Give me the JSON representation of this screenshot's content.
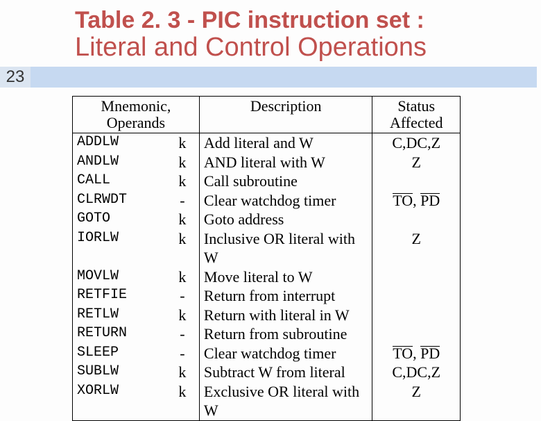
{
  "page_number": "23",
  "title_line1": "Table 2. 3 - PIC instruction set :",
  "title_line2": "Literal and Control Operations",
  "headers": {
    "mnemonic": "Mnemonic,\nOperands",
    "description": "Description",
    "status": "Status\nAffected"
  },
  "rows": [
    {
      "mnemonic": "ADDLW",
      "operand": "k",
      "description": "Add literal and W",
      "status": "C,DC,Z",
      "overline": false
    },
    {
      "mnemonic": "ANDLW",
      "operand": "k",
      "description": "AND literal with W",
      "status": "Z",
      "overline": false
    },
    {
      "mnemonic": "CALL",
      "operand": "k",
      "description": "Call subroutine",
      "status": "",
      "overline": false
    },
    {
      "mnemonic": "CLRWDT",
      "operand": "-",
      "description": "Clear watchdog timer",
      "status": "TO, PD",
      "overline": true
    },
    {
      "mnemonic": "GOTO",
      "operand": "k",
      "description": "Goto address",
      "status": "",
      "overline": false
    },
    {
      "mnemonic": "IORLW",
      "operand": "k",
      "description": "Inclusive OR literal with W",
      "status": "Z",
      "overline": false
    },
    {
      "mnemonic": "MOVLW",
      "operand": "k",
      "description": "Move literal to W",
      "status": "",
      "overline": false
    },
    {
      "mnemonic": "RETFIE",
      "operand": "-",
      "description": "Return from interrupt",
      "status": "",
      "overline": false
    },
    {
      "mnemonic": "RETLW",
      "operand": "k",
      "description": "Return with literal in W",
      "status": "",
      "overline": false
    },
    {
      "mnemonic": "RETURN",
      "operand": "-",
      "description": "Return from subroutine",
      "status": "",
      "overline": false
    },
    {
      "mnemonic": "SLEEP",
      "operand": "-",
      "description": "Clear watchdog timer",
      "status": "TO, PD",
      "overline": true
    },
    {
      "mnemonic": "SUBLW",
      "operand": "k",
      "description": "Subtract W from literal",
      "status": "C,DC,Z",
      "overline": false
    },
    {
      "mnemonic": "XORLW",
      "operand": "k",
      "description": "Exclusive OR literal with W",
      "status": "Z",
      "overline": false
    }
  ]
}
